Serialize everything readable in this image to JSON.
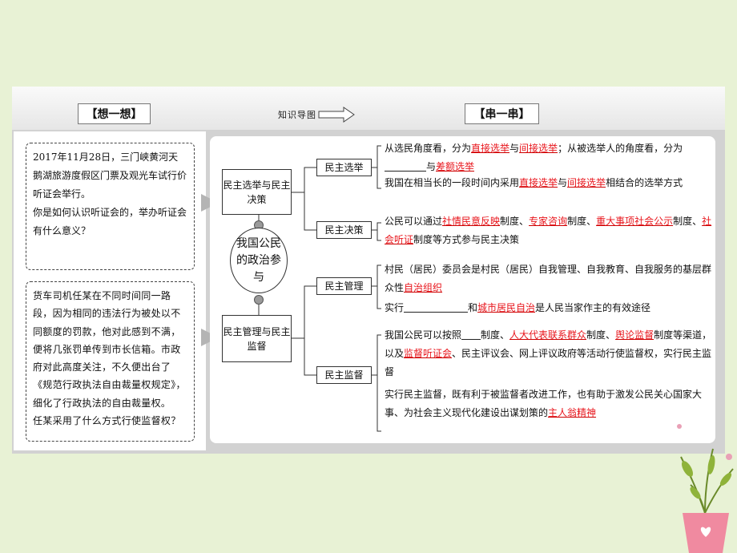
{
  "header": {
    "think_tag": "【想一想】",
    "transition_label": "知识导图",
    "chain_tag": "【串一串】"
  },
  "think": {
    "case1": "2017年11月28日，三门峡黄河天鹅湖旅游度假区门票及观光车试行价听证会举行。",
    "question1": "你是如何认识听证会的，举办听证会有什么意义？",
    "case2": "货车司机任某在不同时间同一路段，因为相同的违法行为被处以不同额度的罚款，他对此感到不满，便将几张罚单传到市长信箱。市政府对此高度关注，不久便出台了《规范行政执法自由裁量权规定》，细化了行政执法的自由裁量权。",
    "question2": "任某采用了什么方式行使监督权？"
  },
  "diagram": {
    "center": "我国公民的政治参与",
    "left_top": "民主选举与民主决策",
    "left_bottom": "民主管理与民主监督",
    "sub1": "民主选举",
    "sub2": "民主决策",
    "sub3": "民主管理",
    "sub4": "民主监督"
  },
  "branches": {
    "election_a1": "从选民角度看，分为",
    "election_a_r1": "直接选举",
    "election_a2": "与",
    "election_a_r2": "间接选举",
    "election_a3": "；从被选举人的角度看，分为",
    "election_a4": "与",
    "election_a_r3": "差额选举",
    "election_b1": "我国在相当长的一段时间内采用",
    "election_b_r1": "直接选举",
    "election_b2": "与",
    "election_b_r2": "间接选举",
    "election_b3": "相结合的选举方式",
    "decision_1": "公民可以通过",
    "decision_r1": "社情民意反映",
    "decision_2": "制度、",
    "decision_r2": "专家咨询",
    "decision_3": "制度、",
    "decision_r3": "重大事项社会公示",
    "decision_4": "制度、",
    "decision_r4": "社会听证",
    "decision_5": "制度等方式参与民主决策",
    "manage_a1": "村民（居民）委员会是村民（居民）自我管理、自我教育、自我服务的基层群众性",
    "manage_a_r1": "自治组织",
    "manage_b1": "实行",
    "manage_b2": "和",
    "manage_b_r1": "城市居民自治",
    "manage_b3": "是人民当家作主的有效途径",
    "super_a1": "我国公民可以按照",
    "super_a2": "制度、",
    "super_a_r1": "人大代表联系群众",
    "super_a3": "制度、",
    "super_a_r2": "舆论监督",
    "super_a4": "制度等渠道，以及",
    "super_a_r3": "监督听证会",
    "super_a5": "、民主评议会、网上评议政府等活动行使监督权，实行民主监督",
    "super_b1": "实行民主监督，既有利于被监督者改进工作，也有助于激发公民关心国家大事、为社会主义现代化建设出谋划策的",
    "super_b_r1": "主人翁精神"
  },
  "colors": {
    "background": "#e8f2d5",
    "answer_red": "#e8141b",
    "pot_pink": "#f08aa0"
  }
}
